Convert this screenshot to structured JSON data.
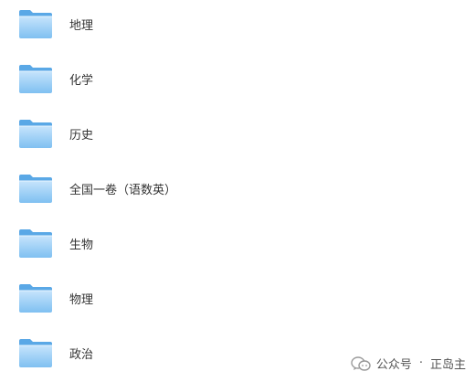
{
  "folders": [
    {
      "label": "地理",
      "icon": "folder-icon"
    },
    {
      "label": "化学",
      "icon": "folder-icon"
    },
    {
      "label": "历史",
      "icon": "folder-icon"
    },
    {
      "label": "全国一卷（语数英）",
      "icon": "folder-icon"
    },
    {
      "label": "生物",
      "icon": "folder-icon"
    },
    {
      "label": "物理",
      "icon": "folder-icon"
    },
    {
      "label": "政治",
      "icon": "folder-icon"
    }
  ],
  "watermark": {
    "prefix": "公众号",
    "separator": "·",
    "name": "正岛主",
    "icon": "wechat-official-account-icon"
  },
  "colors": {
    "folder_back": "#5aa8e6",
    "folder_front_top": "#bfe0fb",
    "folder_front_bottom": "#79bdf0",
    "text": "#333333"
  }
}
